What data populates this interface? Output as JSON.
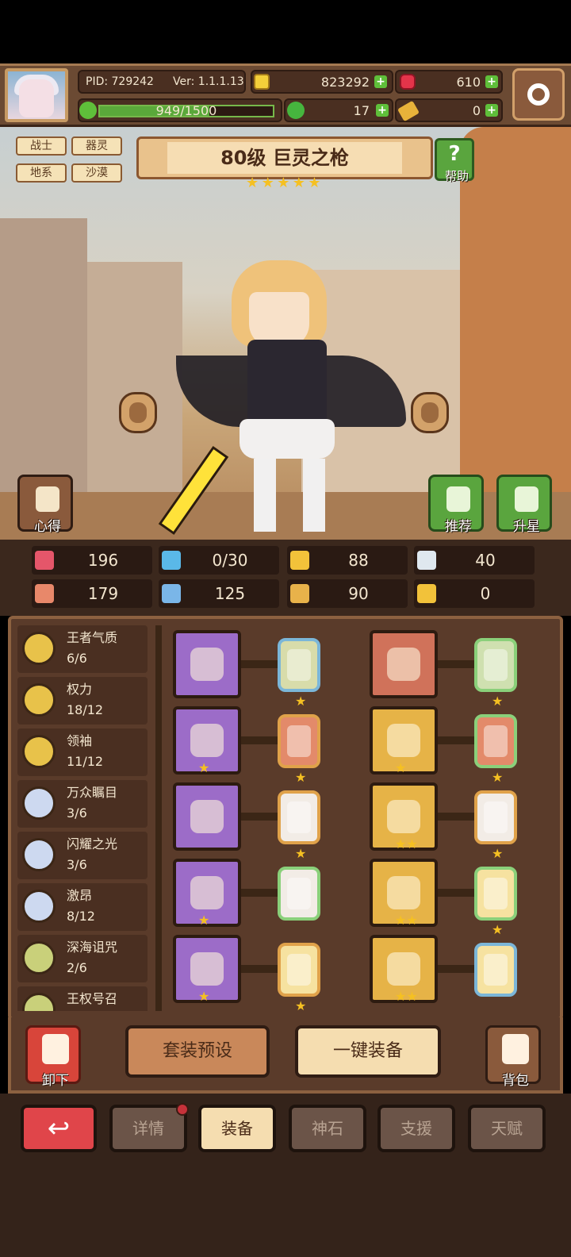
{
  "header": {
    "pid": "PID: 729242",
    "version": "Ver: 1.1.1.13",
    "coins": "823292",
    "gems": "610",
    "exp": "949/1500",
    "exp_fraction": 0.633,
    "clovers": "17",
    "keys": "0"
  },
  "tags": [
    "战士",
    "器灵",
    "地系",
    "沙漠"
  ],
  "hero": {
    "title": "80级 巨灵之枪",
    "stars": 5,
    "help_label": "帮助"
  },
  "scene_buttons": {
    "notes": "心得",
    "recommend": "推荐",
    "upgrade_star": "升星"
  },
  "stats": [
    {
      "icon": "heart-icon",
      "value": "196",
      "color": "#e5566a"
    },
    {
      "icon": "water-drop-icon",
      "value": "0/30",
      "color": "#5ab8e8"
    },
    {
      "icon": "shield-stat-icon",
      "value": "88",
      "color": "#f2c23a"
    },
    {
      "icon": "wing-icon",
      "value": "40",
      "color": "#dfe8ef"
    },
    {
      "icon": "fist-icon",
      "value": "179",
      "color": "#e8886a"
    },
    {
      "icon": "book-icon",
      "value": "125",
      "color": "#7ab6e8"
    },
    {
      "icon": "flag-icon",
      "value": "90",
      "color": "#e8b24a"
    },
    {
      "icon": "horseshoe-icon",
      "value": "0",
      "color": "#f2c23a"
    }
  ],
  "sets": [
    {
      "name": "王者气质",
      "count": "6/6",
      "medal": "#e8c24a"
    },
    {
      "name": "权力",
      "count": "18/12",
      "medal": "#e8c24a"
    },
    {
      "name": "领袖",
      "count": "11/12",
      "medal": "#e8c24a"
    },
    {
      "name": "万众瞩目",
      "count": "3/6",
      "medal": "#cdd9f0"
    },
    {
      "name": "闪耀之光",
      "count": "3/6",
      "medal": "#cdd9f0"
    },
    {
      "name": "激昂",
      "count": "8/12",
      "medal": "#cdd9f0"
    },
    {
      "name": "深海诅咒",
      "count": "2/6",
      "medal": "#c9d07a"
    },
    {
      "name": "王权号召",
      "count": "",
      "medal": "#c9d07a"
    }
  ],
  "actions": {
    "unload": "卸下",
    "preset": "套装预设",
    "equip_all": "一键装备",
    "bag": "背包"
  },
  "tabs": [
    "详情",
    "装备",
    "神石",
    "支援",
    "天赋"
  ],
  "active_tab": "装备"
}
